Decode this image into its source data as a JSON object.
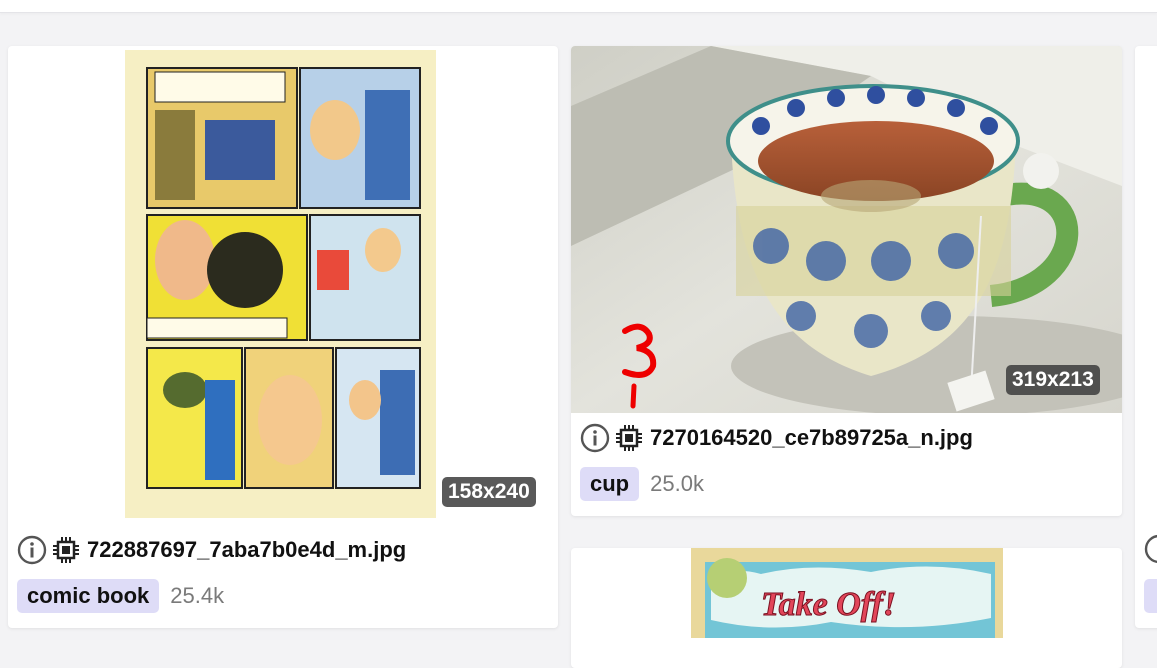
{
  "cards": [
    {
      "thumbnail_alt": "comic book page",
      "dimensions": "158x240",
      "filename": "722887697_7aba7b0e4d_m.jpg",
      "tag": "comic book",
      "count": "25.4k"
    },
    {
      "thumbnail_alt": "tea cup on window sill",
      "dimensions": "319x213",
      "filename": "7270164520_ce7b89725a_n.jpg",
      "tag": "cup",
      "count": "25.0k",
      "annotation": "3"
    },
    {
      "thumbnail_alt": "Take Off! comic",
      "thumbnail_text": "Take Off!"
    }
  ],
  "icons": {
    "info": "info-icon",
    "chip": "chip-icon"
  },
  "colors": {
    "tag_bg": "#dedcf7",
    "badge_bg": "#4a4a4a",
    "page_bg": "#f3f3f5",
    "annotation": "#ee0000"
  }
}
